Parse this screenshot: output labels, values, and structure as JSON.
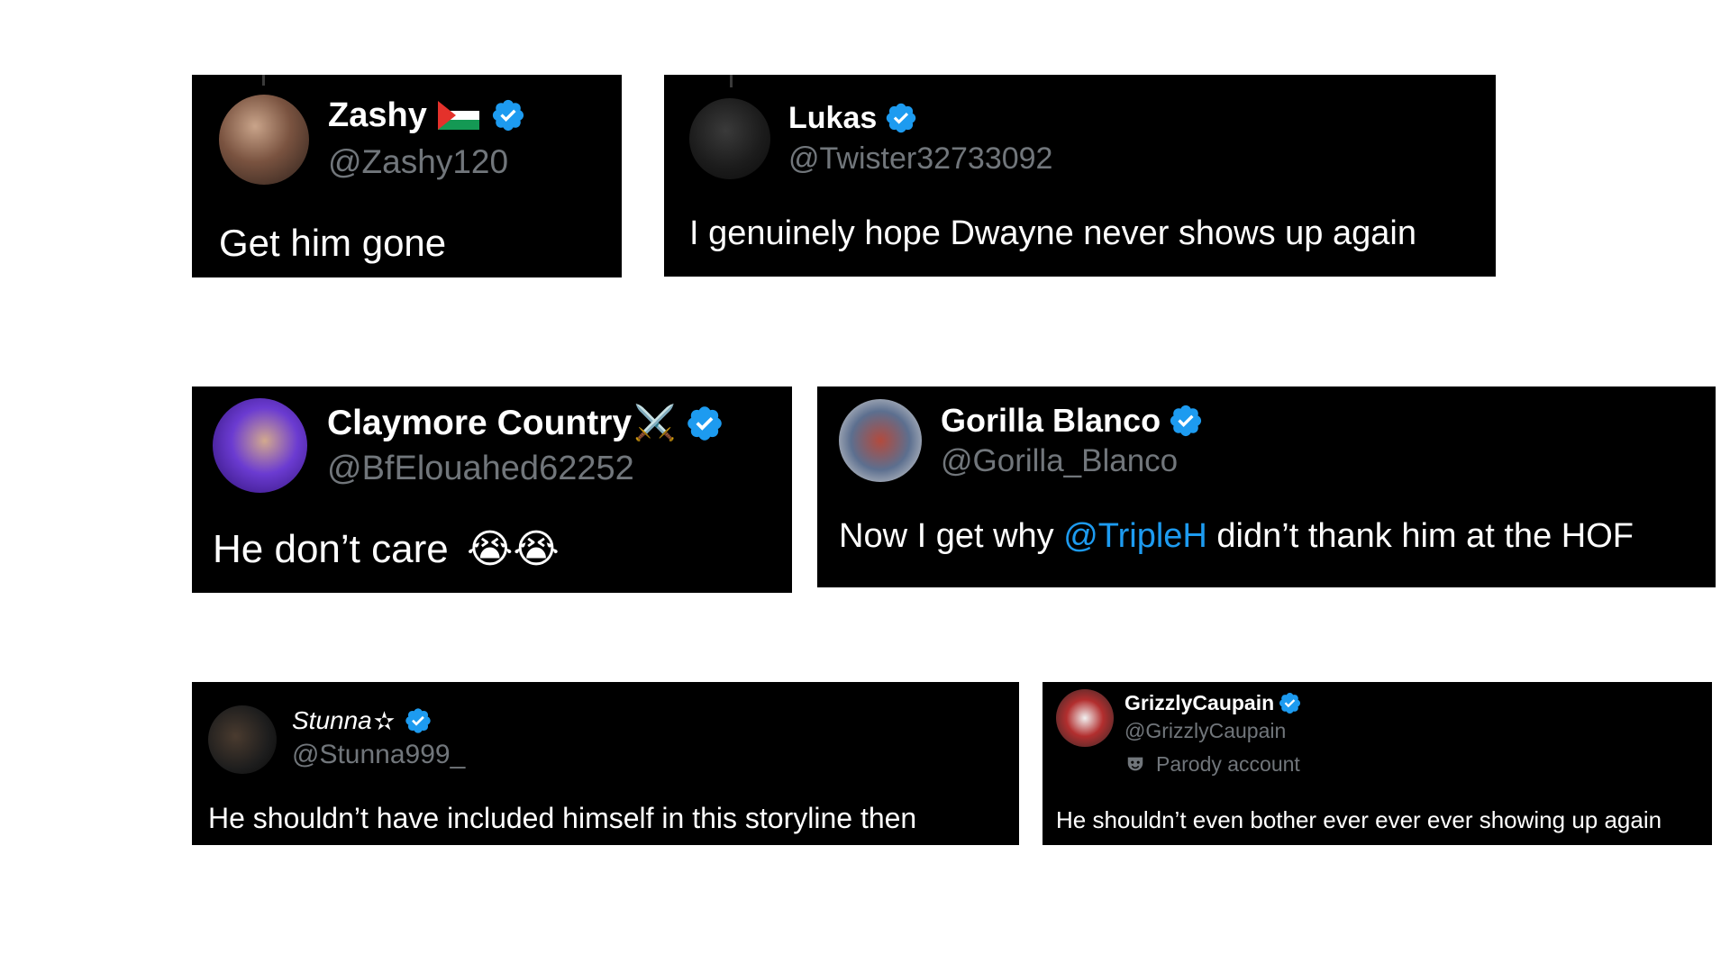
{
  "tweets": [
    {
      "name": "Zashy",
      "handle": "@Zashy120",
      "text": "Get him gone"
    },
    {
      "name": "Lukas",
      "handle": "@Twister32733092",
      "text": "I genuinely hope Dwayne never shows up again"
    },
    {
      "name": "Claymore Country",
      "name_emoji": "⚔️",
      "handle": "@BfElouahed62252",
      "text": "He don’t care",
      "text_emoji": "😭😭"
    },
    {
      "name": "Gorilla Blanco",
      "handle": "@Gorilla_Blanco",
      "text_before": "Now I get why ",
      "mention": "@TripleH",
      "text_after": " didn’t thank him at the HOF"
    },
    {
      "name": "Stunna",
      "name_symbol": "✫",
      "handle": "@Stunna999_",
      "text": "He shouldn’t have included himself in this storyline then"
    },
    {
      "name": "GrizzlyCaupain",
      "handle": "@GrizzlyCaupain",
      "badge_label": "Parody account",
      "text": "He shouldn’t even bother ever ever ever showing up again"
    }
  ],
  "colors": {
    "card_bg": "#000000",
    "name": "#ffffff",
    "handle": "#71767b",
    "verified": "#1d9bf0",
    "mention": "#1d9bf0"
  },
  "icons": {
    "verified": "verified-badge-icon",
    "flag": "palestine-flag-icon",
    "parody": "parody-mask-icon"
  }
}
